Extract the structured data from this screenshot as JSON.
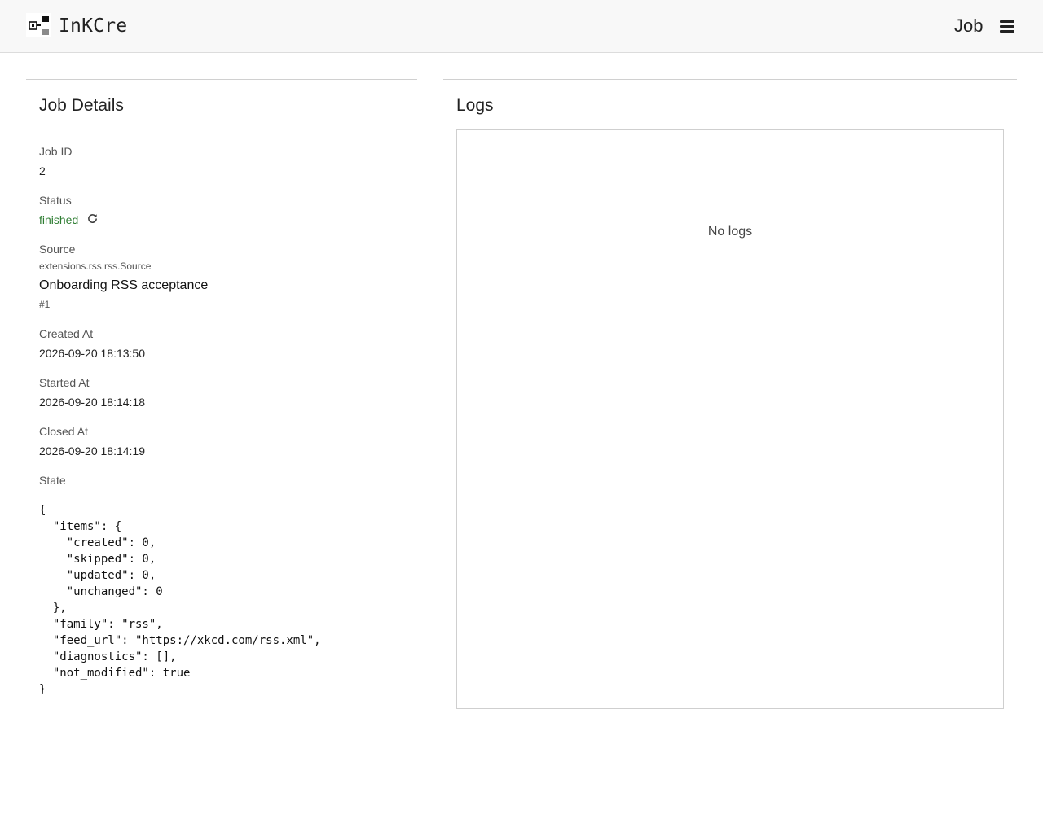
{
  "header": {
    "brand": "InKCre",
    "page_label": "Job",
    "logo_icon": "inkcre-logo-icon",
    "menu_icon": "hamburger-menu-icon"
  },
  "job_details": {
    "title": "Job Details",
    "job_id": {
      "label": "Job ID",
      "value": "2"
    },
    "status": {
      "label": "Status",
      "value": "finished",
      "color": "#2e7d32",
      "icon": "refresh-icon"
    },
    "source": {
      "label": "Source",
      "class_path": "extensions.rss.rss.Source",
      "name": "Onboarding RSS acceptance",
      "id": "#1"
    },
    "created_at": {
      "label": "Created At",
      "value": "2026-09-20 18:13:50"
    },
    "started_at": {
      "label": "Started At",
      "value": "2026-09-20 18:14:18"
    },
    "closed_at": {
      "label": "Closed At",
      "value": "2026-09-20 18:14:19"
    },
    "state": {
      "label": "State",
      "json_text": "{\n  \"items\": {\n    \"created\": 0,\n    \"skipped\": 0,\n    \"updated\": 0,\n    \"unchanged\": 0\n  },\n  \"family\": \"rss\",\n  \"feed_url\": \"https://xkcd.com/rss.xml\",\n  \"diagnostics\": [],\n  \"not_modified\": true\n}"
    }
  },
  "logs": {
    "title": "Logs",
    "empty_text": "No logs"
  }
}
